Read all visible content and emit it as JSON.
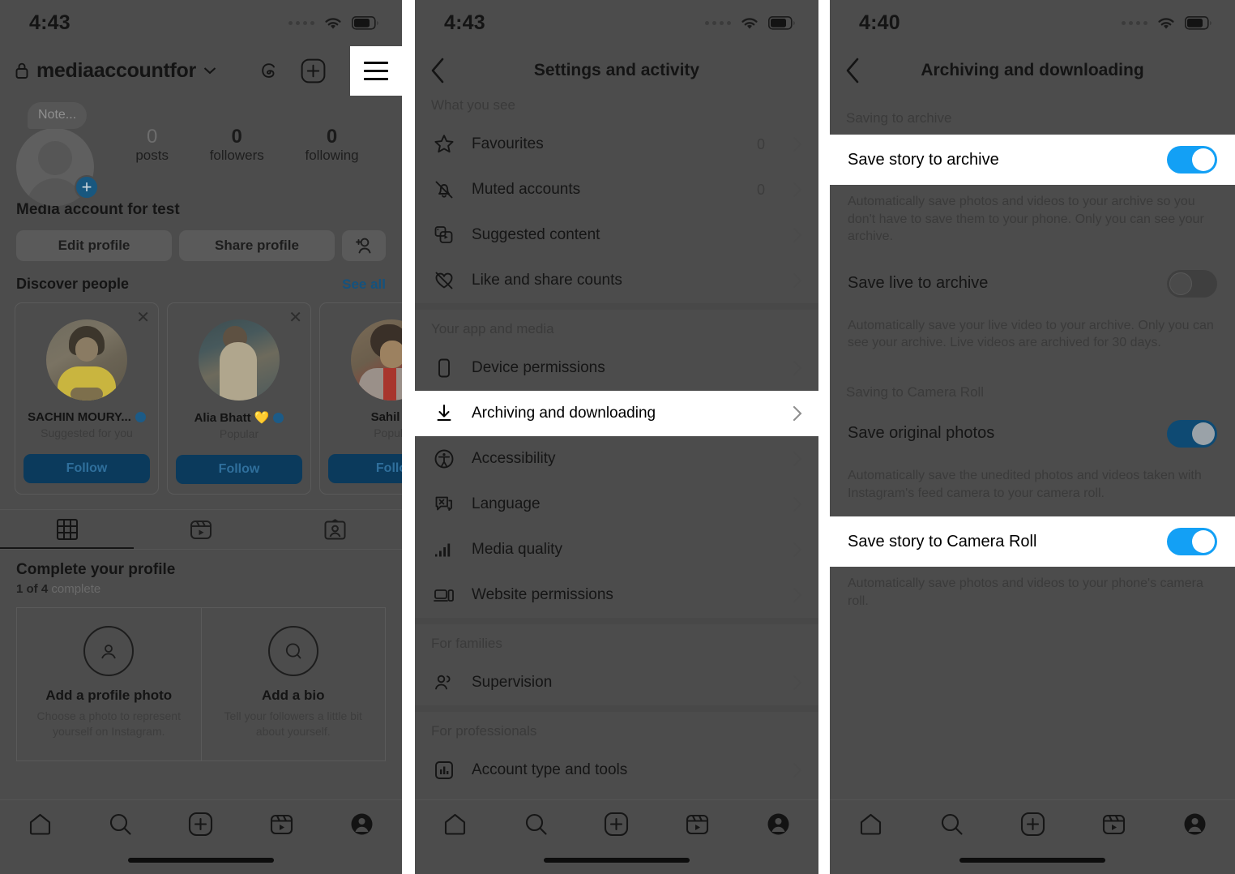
{
  "panel1": {
    "status": {
      "time": "4:43",
      "wifi_icon": "wifi-icon",
      "battery_icon": "battery-icon",
      "signal_icon": "signal-dots-icon"
    },
    "header": {
      "lock_icon": "lock-icon",
      "username": "mediaaccountfor",
      "chevron_icon": "chevron-down-icon",
      "threads_icon": "threads-icon",
      "add_icon": "plus-square-icon",
      "menu_icon": "hamburger-menu-icon"
    },
    "profile": {
      "note_placeholder": "Note...",
      "avatar_icon": "avatar-placeholder-icon",
      "add_story_icon": "plus-badge-icon",
      "stats": [
        {
          "value": "0",
          "label": "posts"
        },
        {
          "value": "0",
          "label": "followers"
        },
        {
          "value": "0",
          "label": "following"
        }
      ],
      "display_name": "Media account for test",
      "buttons": {
        "edit": "Edit profile",
        "share": "Share profile",
        "add_person_icon": "add-person-icon"
      }
    },
    "discover": {
      "title": "Discover people",
      "see_all": "See all",
      "cards": [
        {
          "name": "SACHIN MOURY...",
          "verified": true,
          "subtitle": "Suggested for you",
          "follow": "Follow",
          "close_icon": "close-icon"
        },
        {
          "name": "Alia Bhatt 💛",
          "verified": true,
          "subtitle": "Popular",
          "follow": "Follow",
          "close_icon": "close-icon"
        },
        {
          "name": "Sahil B",
          "verified": false,
          "subtitle": "Popula",
          "follow": "Follo",
          "close_icon": "close-icon"
        }
      ]
    },
    "tabs": [
      {
        "icon": "grid-tab-icon",
        "active": true
      },
      {
        "icon": "reels-tab-icon",
        "active": false
      },
      {
        "icon": "tagged-tab-icon",
        "active": false
      }
    ],
    "complete": {
      "title": "Complete your profile",
      "progress_bold": "1 of 4",
      "progress_rest": " complete",
      "cards": [
        {
          "icon": "profile-photo-icon",
          "title": "Add a profile photo",
          "text": "Choose a photo to represent yourself on Instagram."
        },
        {
          "icon": "bio-bubble-icon",
          "title": "Add a bio",
          "text": "Tell your followers a little bit about yourself."
        }
      ]
    },
    "bottom_nav": [
      "home-icon",
      "search-icon",
      "create-icon",
      "reels-icon",
      "profile-icon"
    ]
  },
  "panel2": {
    "status": {
      "time": "4:43"
    },
    "header": {
      "back_icon": "back-chevron-icon",
      "title": "Settings and activity"
    },
    "sections": [
      {
        "label": "What you see",
        "items": [
          {
            "icon": "star-icon",
            "label": "Favourites",
            "count": "0",
            "chevron": "chevron-right-icon",
            "highlight": false
          },
          {
            "icon": "bell-muted-icon",
            "label": "Muted accounts",
            "count": "0",
            "chevron": "chevron-right-icon",
            "highlight": false
          },
          {
            "icon": "suggested-content-icon",
            "label": "Suggested content",
            "count": "",
            "chevron": "chevron-right-icon",
            "highlight": false
          },
          {
            "icon": "heart-slash-icon",
            "label": "Like and share counts",
            "count": "",
            "chevron": "chevron-right-icon",
            "highlight": false
          }
        ]
      },
      {
        "label": "Your app and media",
        "items": [
          {
            "icon": "device-icon",
            "label": "Device permissions",
            "count": "",
            "chevron": "chevron-right-icon",
            "highlight": false
          },
          {
            "icon": "download-icon",
            "label": "Archiving and downloading",
            "count": "",
            "chevron": "chevron-right-icon",
            "highlight": true
          },
          {
            "icon": "accessibility-icon",
            "label": "Accessibility",
            "count": "",
            "chevron": "chevron-right-icon",
            "highlight": false
          },
          {
            "icon": "language-icon",
            "label": "Language",
            "count": "",
            "chevron": "chevron-right-icon",
            "highlight": false
          },
          {
            "icon": "media-quality-icon",
            "label": "Media quality",
            "count": "",
            "chevron": "chevron-right-icon",
            "highlight": false
          },
          {
            "icon": "website-permissions-icon",
            "label": "Website permissions",
            "count": "",
            "chevron": "chevron-right-icon",
            "highlight": false
          }
        ]
      },
      {
        "label": "For families",
        "items": [
          {
            "icon": "supervision-icon",
            "label": "Supervision",
            "count": "",
            "chevron": "chevron-right-icon",
            "highlight": false
          }
        ]
      },
      {
        "label": "For professionals",
        "items": [
          {
            "icon": "account-tools-icon",
            "label": "Account type and tools",
            "count": "",
            "chevron": "chevron-right-icon",
            "highlight": false
          }
        ]
      }
    ],
    "bottom_nav": [
      "home-icon",
      "search-icon",
      "create-icon",
      "reels-icon",
      "profile-icon"
    ]
  },
  "panel3": {
    "status": {
      "time": "4:40"
    },
    "header": {
      "back_icon": "back-chevron-icon",
      "title": "Archiving and downloading"
    },
    "groups": [
      {
        "label": "Saving to archive",
        "rows": [
          {
            "label": "Save story to archive",
            "toggle": "on",
            "highlight": true,
            "description": "Automatically save photos and videos to your archive so you don't have to save them to your phone. Only you can see your archive."
          },
          {
            "label": "Save live to archive",
            "toggle": "off",
            "highlight": false,
            "description": "Automatically save your live video to your archive. Only you can see your archive. Live videos are archived for 30 days."
          }
        ]
      },
      {
        "label": "Saving to Camera Roll",
        "rows": [
          {
            "label": "Save original photos",
            "toggle": "on",
            "highlight": false,
            "description": "Automatically save the unedited photos and videos taken with Instagram's feed camera to your camera roll."
          },
          {
            "label": "Save story to Camera Roll",
            "toggle": "on",
            "highlight": true,
            "description": "Automatically save photos and videos to your phone's camera roll."
          }
        ]
      }
    ],
    "bottom_nav": [
      "home-icon",
      "search-icon",
      "create-icon",
      "reels-icon",
      "profile-icon"
    ]
  },
  "colors": {
    "dim_background": "#4c4c4c",
    "highlight_background": "#ffffff",
    "toggle_on_bright": "#13a0f5",
    "toggle_on_dim": "#0e4a73",
    "toggle_off_dim": "#3f3f3f",
    "link_blue_dim": "#14527e",
    "follow_button_dim": "#0b3a5c"
  }
}
